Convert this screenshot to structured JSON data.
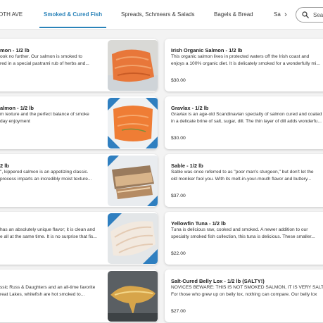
{
  "nav": {
    "tabs": [
      "OTH AVE",
      "Smoked & Cured Fish",
      "Spreads, Schmears & Salads",
      "Bagels & Bread",
      "Sa"
    ],
    "active_index": 1,
    "search_label": "Sear"
  },
  "left_items": [
    {
      "title": "mon - 1/2 lb",
      "desc": [
        "ook no further. Our salmon is smoked to",
        "red in a special pastrami rub of herbs and..."
      ],
      "price": ""
    },
    {
      "title": "almon - 1/2 lb",
      "desc": [
        "m texture and the perfect balance of smoke",
        "day enjoyment"
      ],
      "price": ""
    },
    {
      "title": "2 lb",
      "desc": [
        "\", kippered salmon is an appetizing classic.",
        "process imparts an incredibly moist texture..."
      ],
      "price": ""
    },
    {
      "title": "",
      "desc": [
        "has an absolutely unique flavor; it is clean and",
        "e all at the same time. It is no surprise that fis..."
      ],
      "price": ""
    },
    {
      "title": "",
      "desc": [
        "ssic Russ & Daughters and an all-time favorite",
        "reat Lakes, whitefish are hot smoked to..."
      ],
      "price": ""
    }
  ],
  "right_items": [
    {
      "title": "Irish Organic Salmon - 1/2 lb",
      "desc": [
        "This organic salmon lives in protected waters off the Irish coast and",
        "enjoys a 100% organic diet. It is delicately smoked for a wonderfully mi..."
      ],
      "price": "$30.00"
    },
    {
      "title": "Gravlax - 1/2 lb",
      "desc": [
        "Gravlax is an age-old Scandinavian specialty of salmon cured and coated",
        "in a delicate brine of salt, sugar, dill. The thin layer of dill adds wonderfu..."
      ],
      "price": "$30.00"
    },
    {
      "title": "Sable - 1/2 lb",
      "desc": [
        "Sable was once referred to as \"poor man's sturgeon,\" but don't let the",
        "old moniker fool you. With its melt-in-your-mouth flavor and buttery..."
      ],
      "price": "$37.00"
    },
    {
      "title": "Yellowfin Tuna - 1/2 lb",
      "desc": [
        "Tuna is delicious raw, cooked and smoked. A newer addition to our",
        "specialty smoked fish collection, this tuna is delicious. These smaller..."
      ],
      "price": "$22.00"
    },
    {
      "title": "Salt-Cured Belly Lox - 1/2 lb (SALTY!)",
      "desc": [
        "NOVICES BEWARE: THIS IS NOT SMOKED SALMON, IT IS VERY SALTY",
        "For those who grew up on belly lox, nothing can compare. Our belly lox"
      ],
      "price": "$27.00"
    }
  ],
  "colors": {
    "accent": "#2a83b9",
    "background": "#f3f3f3",
    "card": "#ffffff"
  }
}
